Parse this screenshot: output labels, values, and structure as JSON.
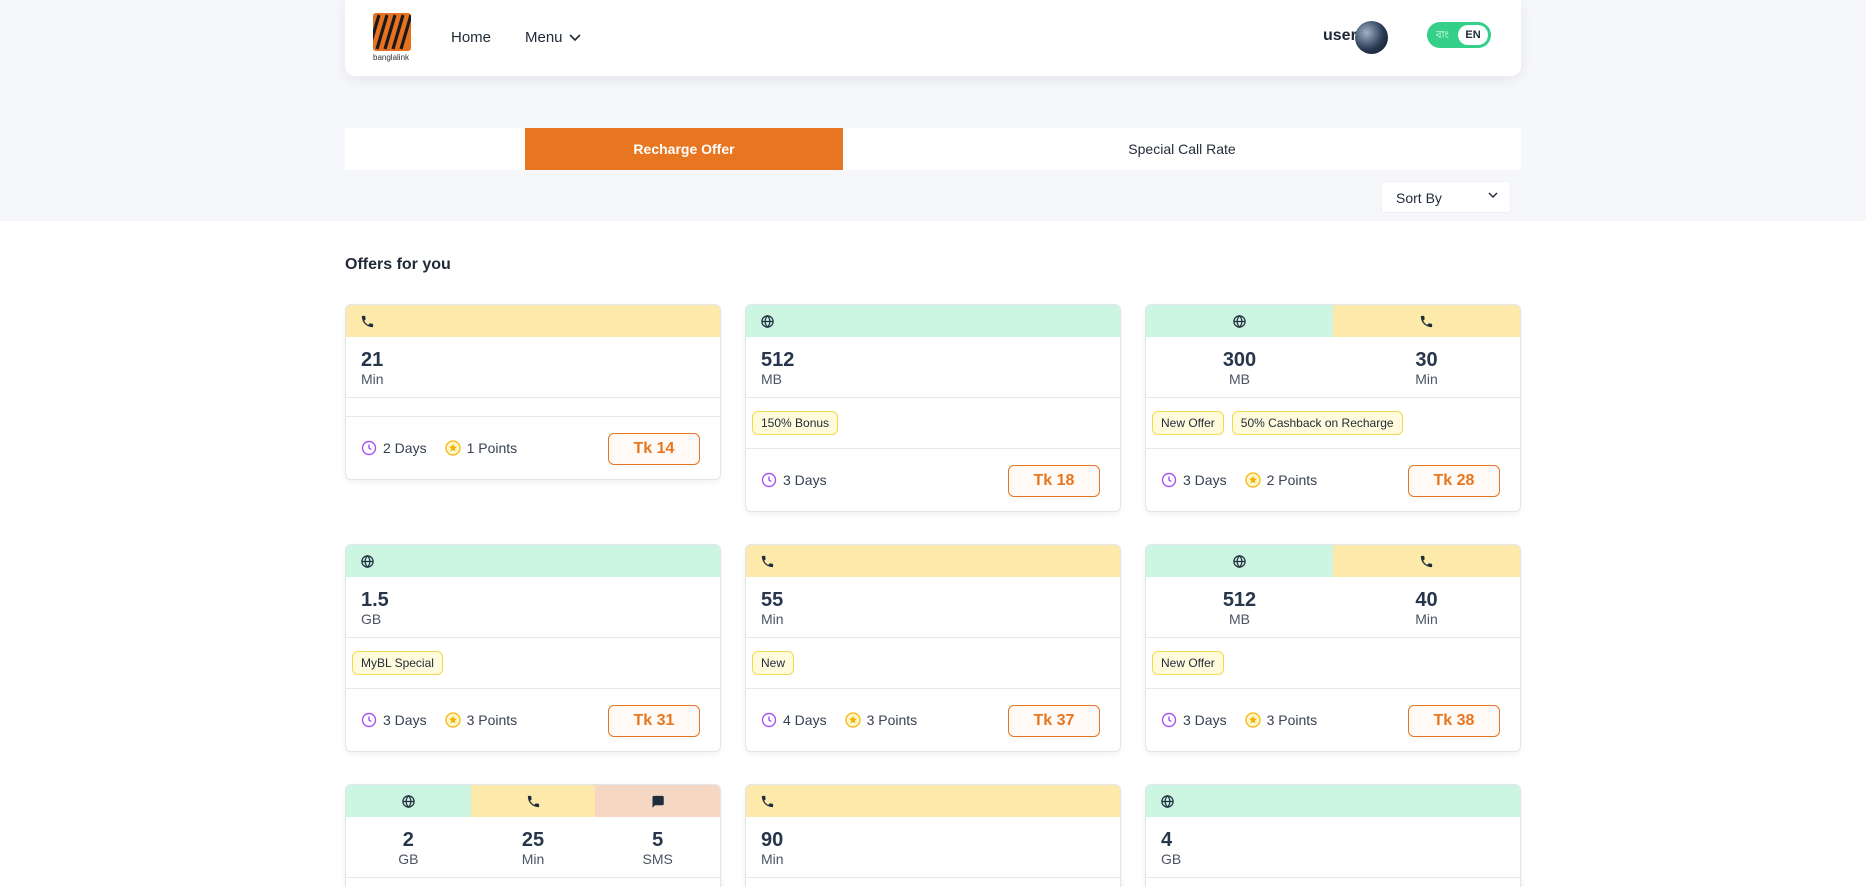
{
  "header": {
    "logo_text": "banglalink",
    "nav_home": "Home",
    "nav_menu": "Menu",
    "user_label": "user",
    "lang_bn": "বাং",
    "lang_en": "EN"
  },
  "tabs": [
    {
      "label": "Recharge Offer",
      "active": true
    },
    {
      "label": "Special Call Rate",
      "active": false
    }
  ],
  "sort_label": "Sort By",
  "section_title": "Offers for you",
  "colors": {
    "accent": "#e8751f",
    "internet": "#ccf5e2",
    "voice": "#fde9aa",
    "sms": "#f6d7c4",
    "toggle": "#34d08a"
  },
  "offers": [
    {
      "benefits": [
        {
          "icon": "phone-icon",
          "amount": "21",
          "unit": "Min"
        }
      ],
      "tags": [],
      "validity": "2 Days",
      "points": "1 Points",
      "price": "Tk 14"
    },
    {
      "benefits": [
        {
          "icon": "globe-icon",
          "amount": "512",
          "unit": "MB"
        }
      ],
      "tags": [
        "150% Bonus"
      ],
      "validity": "3 Days",
      "points": "",
      "price": "Tk 18"
    },
    {
      "benefits": [
        {
          "icon": "globe-icon",
          "amount": "300",
          "unit": "MB"
        },
        {
          "icon": "phone-icon",
          "amount": "30",
          "unit": "Min"
        }
      ],
      "tags": [
        "New Offer",
        "50% Cashback on Recharge"
      ],
      "validity": "3 Days",
      "points": "2 Points",
      "price": "Tk 28"
    },
    {
      "benefits": [
        {
          "icon": "globe-icon",
          "amount": "1.5",
          "unit": "GB"
        }
      ],
      "tags": [
        "MyBL Special"
      ],
      "validity": "3 Days",
      "points": "3 Points",
      "price": "Tk 31"
    },
    {
      "benefits": [
        {
          "icon": "phone-icon",
          "amount": "55",
          "unit": "Min"
        }
      ],
      "tags": [
        "New"
      ],
      "validity": "4 Days",
      "points": "3 Points",
      "price": "Tk 37"
    },
    {
      "benefits": [
        {
          "icon": "globe-icon",
          "amount": "512",
          "unit": "MB"
        },
        {
          "icon": "phone-icon",
          "amount": "40",
          "unit": "Min"
        }
      ],
      "tags": [
        "New Offer"
      ],
      "validity": "3 Days",
      "points": "3 Points",
      "price": "Tk 38"
    },
    {
      "benefits": [
        {
          "icon": "globe-icon",
          "amount": "2",
          "unit": "GB"
        },
        {
          "icon": "phone-icon",
          "amount": "25",
          "unit": "Min"
        },
        {
          "icon": "sms-icon",
          "amount": "5",
          "unit": "SMS"
        }
      ],
      "tags": [],
      "validity": "",
      "points": "",
      "price": ""
    },
    {
      "benefits": [
        {
          "icon": "phone-icon",
          "amount": "90",
          "unit": "Min"
        }
      ],
      "tags": [],
      "validity": "",
      "points": "",
      "price": ""
    },
    {
      "benefits": [
        {
          "icon": "globe-icon",
          "amount": "4",
          "unit": "GB"
        }
      ],
      "tags": [],
      "validity": "",
      "points": "",
      "price": ""
    }
  ]
}
